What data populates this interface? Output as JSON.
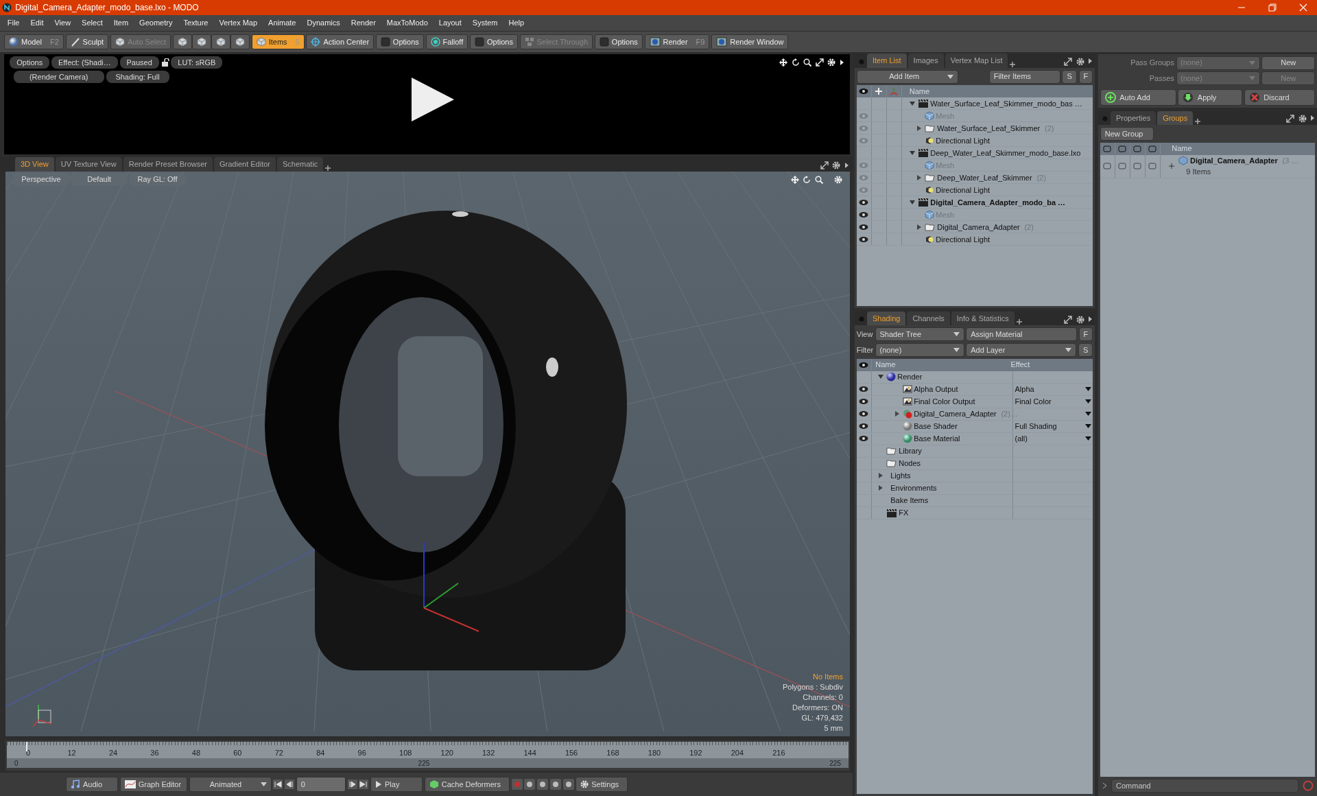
{
  "window": {
    "title": "Digital_Camera_Adapter_modo_base.lxo - MODO"
  },
  "menu": [
    "File",
    "Edit",
    "View",
    "Select",
    "Item",
    "Geometry",
    "Texture",
    "Vertex Map",
    "Animate",
    "Dynamics",
    "Render",
    "MaxToModo",
    "Layout",
    "System",
    "Help"
  ],
  "toolbar": [
    {
      "kind": "mode",
      "label": "Model",
      "shortcut": "F2",
      "selected": false,
      "disabled": false
    },
    {
      "kind": "mode",
      "label": "Sculpt",
      "selected": false,
      "disabled": false
    },
    {
      "kind": "mode",
      "label": "Auto Select",
      "selected": false,
      "disabled": true
    },
    {
      "kind": "selectors"
    },
    {
      "kind": "mode",
      "label": "Items",
      "shortcut": "5",
      "selected": true,
      "disabled": false
    },
    {
      "kind": "mode",
      "label": "Action Center",
      "selected": false,
      "disabled": false
    },
    {
      "kind": "mode",
      "label": "Options",
      "selected": false,
      "disabled": false
    },
    {
      "kind": "mode",
      "label": "Falloff",
      "selected": false,
      "disabled": false
    },
    {
      "kind": "mode",
      "label": "Options",
      "selected": false,
      "disabled": false
    },
    {
      "kind": "mode",
      "label": "Select Through",
      "selected": false,
      "disabled": true
    },
    {
      "kind": "mode",
      "label": "Options",
      "selected": false,
      "disabled": false
    },
    {
      "kind": "mode",
      "label": "Render",
      "shortcut": "F9",
      "selected": false,
      "disabled": false
    },
    {
      "kind": "mode",
      "label": "Render Window",
      "selected": false,
      "disabled": false
    }
  ],
  "render_preview": {
    "row1": [
      "Options",
      "Effect: (Shadi…",
      "Paused"
    ],
    "lut": "LUT: sRGB",
    "row2": [
      "(Render Camera)",
      "Shading: Full"
    ]
  },
  "viewport_tabs": [
    {
      "label": "3D View",
      "selected": true
    },
    {
      "label": "UV Texture View",
      "selected": false
    },
    {
      "label": "Render Preset Browser",
      "selected": false
    },
    {
      "label": "Gradient Editor",
      "selected": false
    },
    {
      "label": "Schematic",
      "selected": false
    }
  ],
  "viewport": {
    "buttons": [
      "Perspective",
      "Default",
      "Ray GL: Off"
    ],
    "status": "No Items",
    "info": [
      "Polygons : Subdiv",
      "Channels: 0",
      "Deformers: ON",
      "GL: 479,432",
      "5 mm"
    ]
  },
  "timeline": {
    "ticks": [
      "0",
      "12",
      "24",
      "36",
      "48",
      "60",
      "72",
      "84",
      "96",
      "108",
      "120",
      "132",
      "144",
      "156",
      "168",
      "180",
      "192",
      "204",
      "216"
    ],
    "range": [
      "0",
      "225",
      "225"
    ]
  },
  "transport": {
    "audio": "Audio",
    "graph_editor": "Graph Editor",
    "mode": "Animated",
    "frame": "0",
    "play": "Play",
    "cache": "Cache Deformers",
    "settings": "Settings"
  },
  "item_list": {
    "tabs": [
      {
        "label": "Item List",
        "selected": true
      },
      {
        "label": "Images",
        "selected": false
      },
      {
        "label": "Vertex Map List",
        "selected": false
      }
    ],
    "add_item": "Add Item",
    "filter": "Filter Items",
    "buttons": [
      "S",
      "F"
    ],
    "column": "Name",
    "items": [
      {
        "name": "Water_Surface_Leaf_Skimmer_modo_bas …",
        "kind": "scene",
        "current": false,
        "expanded": true,
        "children": [
          {
            "name": "Mesh",
            "kind": "mesh",
            "visible": false
          },
          {
            "name": "Water_Surface_Leaf_Skimmer",
            "count": "(2)",
            "kind": "group",
            "visible": false,
            "expanded": false
          },
          {
            "name": "Directional Light",
            "kind": "light",
            "visible": false
          }
        ]
      },
      {
        "name": "Deep_Water_Leaf_Skimmer_modo_base.lxo",
        "kind": "scene",
        "current": false,
        "expanded": true,
        "children": [
          {
            "name": "Mesh",
            "kind": "mesh",
            "visible": false
          },
          {
            "name": "Deep_Water_Leaf_Skimmer",
            "count": "(2)",
            "kind": "group",
            "visible": false,
            "expanded": false
          },
          {
            "name": "Directional Light",
            "kind": "light",
            "visible": false
          }
        ]
      },
      {
        "name": "Digital_Camera_Adapter_modo_ba …",
        "kind": "scene",
        "visible": true,
        "current": true,
        "expanded": true,
        "children": [
          {
            "name": "Mesh",
            "kind": "mesh",
            "visible": true
          },
          {
            "name": "Digital_Camera_Adapter",
            "count": "(2)",
            "kind": "group",
            "visible": true,
            "expanded": false
          },
          {
            "name": "Directional Light",
            "kind": "light",
            "visible": true
          }
        ]
      }
    ]
  },
  "shading": {
    "tabs": [
      {
        "label": "Shading",
        "selected": true
      },
      {
        "label": "Channels",
        "selected": false
      },
      {
        "label": "Info & Statistics",
        "selected": false
      }
    ],
    "view_label": "View",
    "view": "Shader Tree",
    "assign": "Assign Material",
    "f": "F",
    "filter_label": "Filter",
    "filter": "(none)",
    "add_layer": "Add Layer",
    "s": "S",
    "columns": [
      "Name",
      "Effect"
    ],
    "items": [
      {
        "name": "Render",
        "kind": "render",
        "expanded": true,
        "children": [
          {
            "name": "Alpha Output",
            "kind": "output",
            "visible": true,
            "effect": "Alpha"
          },
          {
            "name": "Final Color Output",
            "kind": "output",
            "visible": true,
            "effect": "Final Color"
          },
          {
            "name": "Digital_Camera_Adapter",
            "count": "(2)…",
            "kind": "material",
            "visible": true,
            "expanded": false
          },
          {
            "name": "Base Shader",
            "kind": "shader",
            "visible": true,
            "effect": "Full Shading"
          },
          {
            "name": "Base Material",
            "kind": "basematerial",
            "visible": true,
            "effect": "(all)"
          }
        ]
      },
      {
        "name": "Library",
        "kind": "folder"
      },
      {
        "name": "Nodes",
        "kind": "folder"
      },
      {
        "name": "Lights",
        "kind": "category",
        "expanded": false
      },
      {
        "name": "Environments",
        "kind": "category",
        "expanded": false
      },
      {
        "name": "Bake Items",
        "kind": "category"
      },
      {
        "name": "FX",
        "kind": "fx"
      }
    ]
  },
  "passes": {
    "rows": [
      {
        "label": "Pass Groups",
        "value": "(none)",
        "button": "New",
        "disabled": false
      },
      {
        "label": "Passes",
        "value": "(none)",
        "button": "New",
        "disabled": true
      }
    ],
    "actions": [
      "Auto Add",
      "Apply",
      "Discard"
    ]
  },
  "groups": {
    "tabs": [
      {
        "label": "Properties",
        "selected": false
      },
      {
        "label": "Groups",
        "selected": true
      }
    ],
    "new_group": "New Group",
    "column": "Name",
    "items": [
      {
        "name": "Digital_Camera_Adapter",
        "count": "(3 …",
        "detail": "9 Items"
      }
    ]
  },
  "command": {
    "placeholder": "Command"
  }
}
